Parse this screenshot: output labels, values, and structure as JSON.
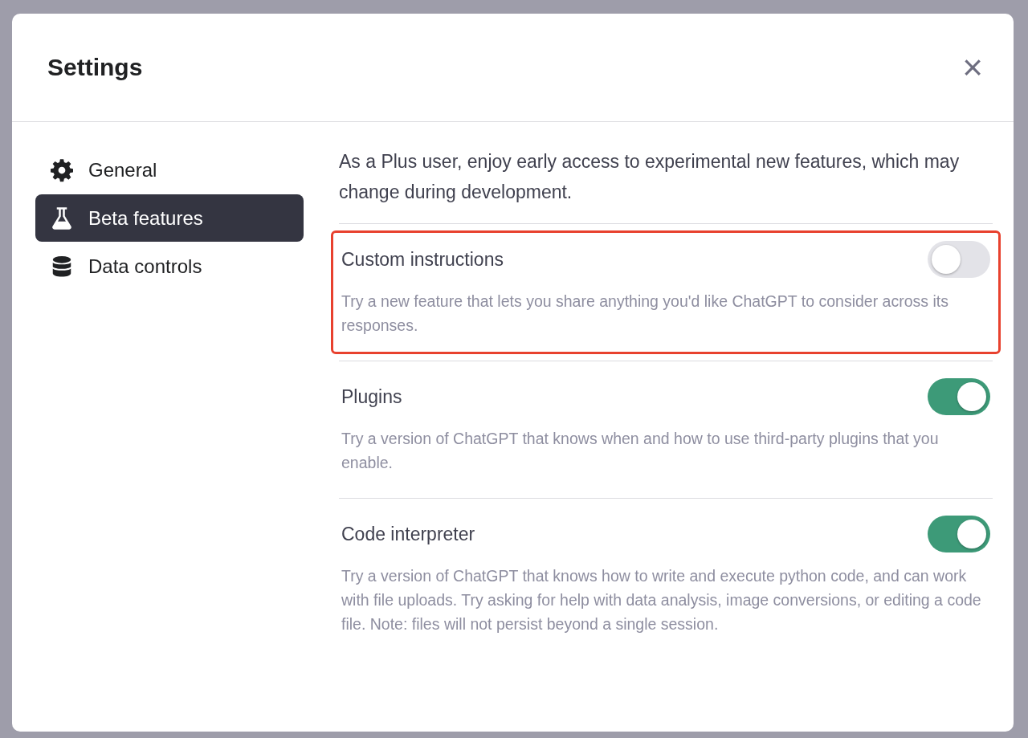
{
  "dialog": {
    "title": "Settings",
    "close": "×"
  },
  "sidebar": {
    "items": [
      {
        "kind": "gear",
        "label": "General",
        "selected": false
      },
      {
        "kind": "flask",
        "label": "Beta features",
        "selected": true
      },
      {
        "kind": "database",
        "label": "Data controls",
        "selected": false
      }
    ]
  },
  "intro": "As a Plus user, enjoy early access to experimental new features, which may change during development.",
  "features": [
    {
      "title": "Custom instructions",
      "description": "Try a new feature that lets you share anything you'd like ChatGPT to consider across its responses.",
      "on": false,
      "highlighted": true
    },
    {
      "title": "Plugins",
      "description": "Try a version of ChatGPT that knows when and how to use third-party plugins that you enable.",
      "on": true,
      "highlighted": false
    },
    {
      "title": "Code interpreter",
      "description": "Try a version of ChatGPT that knows how to write and execute python code, and can work with file uploads. Try asking for help with data analysis, image conversions, or editing a code file. Note: files will not persist beyond a single session.",
      "on": true,
      "highlighted": false
    }
  ]
}
